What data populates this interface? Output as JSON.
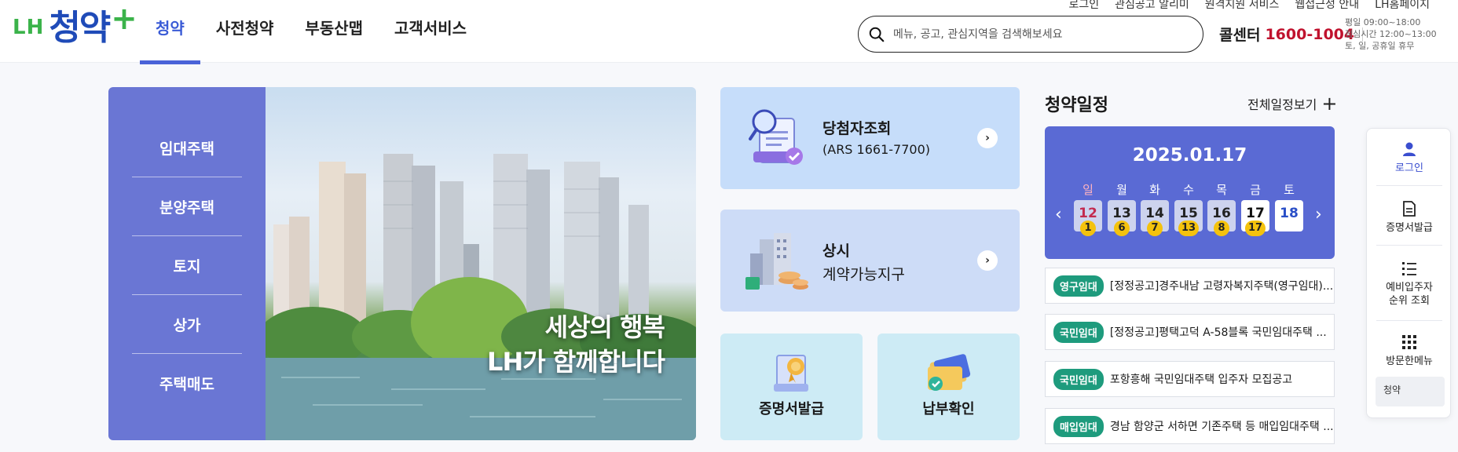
{
  "header": {
    "logo": {
      "lh": "LH",
      "main": "청약",
      "plus": "+"
    },
    "nav": [
      {
        "label": "청약"
      },
      {
        "label": "사전청약"
      },
      {
        "label": "부동산맵"
      },
      {
        "label": "고객서비스"
      }
    ],
    "util_links": [
      "로그인",
      "관심공고 알리미",
      "원격지원 서비스",
      "웹접근성 안내",
      "LH홈페이지"
    ],
    "search": {
      "placeholder": "메뉴, 공고, 관심지역을 검색해보세요"
    },
    "callcenter": {
      "label": "콜센터",
      "number": "1600-1004"
    },
    "hours": [
      "평일 09:00~18:00",
      "점심시간 12:00~13:00",
      "토, 일, 공휴일 휴무"
    ]
  },
  "left_menu": [
    "임대주택",
    "분양주택",
    "토지",
    "상가",
    "주택매도"
  ],
  "banner": {
    "line1": "세상의 행복",
    "line2": "LH가 함께합니다"
  },
  "quick_cards": {
    "winner": {
      "title": "당첨자조회",
      "sub": "(ARS 1661-7700)",
      "arrow": "›"
    },
    "contract": {
      "title": "상시",
      "sub": "계약가능지구",
      "arrow": "›"
    },
    "certificate": {
      "label": "증명서발급"
    },
    "payment": {
      "label": "납부확인"
    }
  },
  "schedule": {
    "title": "청약일정",
    "view_all": "전체일정보기",
    "view_all_icon": "+",
    "date": "2025.01.17",
    "prev": "‹",
    "next": "›",
    "weekdays": [
      "일",
      "월",
      "화",
      "수",
      "목",
      "금",
      "토"
    ],
    "days": [
      {
        "day": "12",
        "count": "1"
      },
      {
        "day": "13",
        "count": "6"
      },
      {
        "day": "14",
        "count": "7"
      },
      {
        "day": "15",
        "count": "13"
      },
      {
        "day": "16",
        "count": "8"
      },
      {
        "day": "17",
        "count": "17"
      },
      {
        "day": "18",
        "count": ""
      }
    ],
    "notices": [
      {
        "badge": "영구임대",
        "text": "[정정공고]경주내남 고령자복지주택(영구임대)..."
      },
      {
        "badge": "국민임대",
        "text": "[정정공고]평택고덕 A-58블록 국민임대주택 ..."
      },
      {
        "badge": "국민임대",
        "text": "포항흥해 국민임대주택 입주자 모집공고"
      },
      {
        "badge": "매입임대",
        "text": "경남 함양군 서하면 기존주택 등 매입임대주택 ..."
      }
    ]
  },
  "quick_bar": {
    "items": [
      {
        "label": "로그인"
      },
      {
        "label": "증명서발급"
      },
      {
        "label": "예비입주자 순위 조회"
      },
      {
        "label": "방문한메뉴"
      }
    ],
    "recent": "청약"
  },
  "colors": {
    "brand_blue": "#1f4bb8",
    "brand_green": "#3bb34a",
    "menu_purple": "#6a76d4",
    "calendar_blue": "#5a6ad4",
    "badge_green": "#1e9b7d",
    "call_red": "#c0122e"
  }
}
